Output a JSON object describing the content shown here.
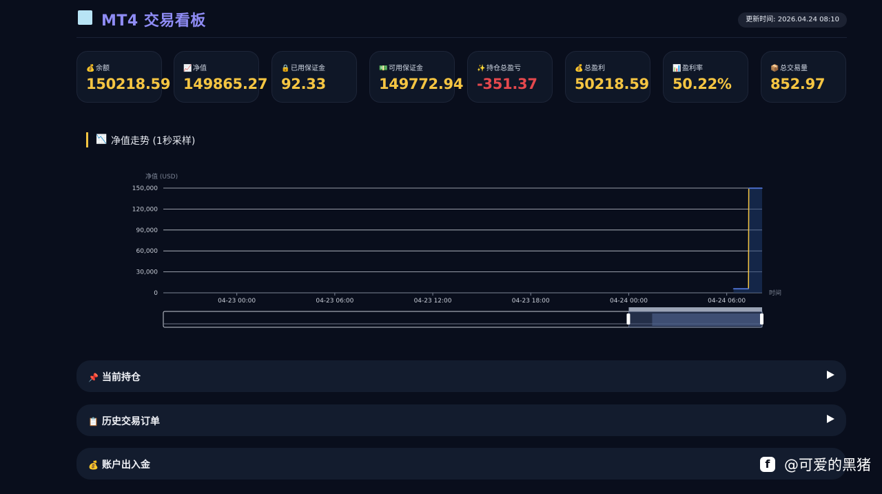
{
  "header": {
    "title": "MT4 交易看板",
    "update_time": "更新时间: 2026.04.24 08:10"
  },
  "cards": [
    {
      "icon": "money-bag-icon",
      "glyph": "💰",
      "label": "余额",
      "value": "150218.59",
      "negative": false
    },
    {
      "icon": "chart-up-icon",
      "glyph": "📈",
      "label": "净值",
      "value": "149865.27",
      "negative": false
    },
    {
      "icon": "lock-icon",
      "glyph": "🔒",
      "label": "已用保证金",
      "value": "92.33",
      "negative": false
    },
    {
      "icon": "cash-icon",
      "glyph": "💵",
      "label": "可用保证金",
      "value": "149772.94",
      "negative": false
    },
    {
      "icon": "sparkle-icon",
      "glyph": "✨",
      "label": "持仓总盈亏",
      "value": "-351.37",
      "negative": true
    },
    {
      "icon": "money-bag-icon",
      "glyph": "💰",
      "label": "总盈利",
      "value": "50218.59",
      "negative": false
    },
    {
      "icon": "bar-chart-icon",
      "glyph": "📊",
      "label": "盈利率",
      "value": "50.22%",
      "negative": false
    },
    {
      "icon": "package-icon",
      "glyph": "📦",
      "label": "总交易量",
      "value": "852.97",
      "negative": false
    }
  ],
  "equity_section": {
    "icon": "chart-icon",
    "title": "净值走势 (1秒采样)"
  },
  "chart_data": {
    "type": "line",
    "title": "净值走势 (1秒采样)",
    "ylabel": "净值 (USD)",
    "xlabel": "时间",
    "y_ticks": [
      "0",
      "30,000",
      "60,000",
      "90,000",
      "120,000",
      "150,000"
    ],
    "ylim": [
      0,
      150000
    ],
    "x_ticks": [
      "04-23 00:00",
      "04-23 06:00",
      "04-23 12:00",
      "04-23 18:00",
      "04-24 00:00",
      "04-24 06:00"
    ],
    "xlim": [
      "04-22 19:30",
      "04-24 08:10"
    ],
    "grid": true,
    "series": [
      {
        "color": "#f5c542",
        "points": [
          {
            "x": "04-24 06:25",
            "y": 5800
          },
          {
            "x": "04-24 07:20",
            "y": 5800
          },
          {
            "x": "04-24 07:21",
            "y": 149865
          },
          {
            "x": "04-24 08:10",
            "y": 149865
          }
        ]
      }
    ],
    "zoom": {
      "start": "04-24 00:00",
      "end": "04-24 08:10"
    }
  },
  "panels": [
    {
      "icon": "pushpin-icon",
      "glyph": "📌",
      "label": "当前持仓"
    },
    {
      "icon": "clipboard-icon",
      "glyph": "📋",
      "label": "历史交易订单"
    },
    {
      "icon": "money-bag-icon",
      "glyph": "💰",
      "label": "账户出入金"
    }
  ],
  "watermark": {
    "logo": "f",
    "text": "@可爱的黑猪"
  }
}
